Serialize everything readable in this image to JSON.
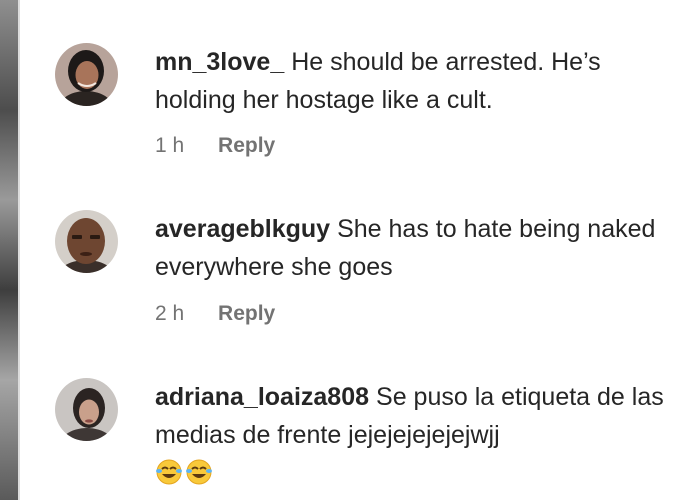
{
  "comments": [
    {
      "username": "mn_3love_",
      "text": "He should be arrested. He’s holding her hostage like a cult.",
      "time": "1 h",
      "reply_label": "Reply"
    },
    {
      "username": "averageblkguy",
      "text": "She has to hate being naked everywhere she goes",
      "time": "2 h",
      "reply_label": "Reply"
    },
    {
      "username": "adriana_loaiza808",
      "text": "Se puso la etiqueta de las medias de frente jejejejejejejwjj",
      "emoji": "😂😂"
    }
  ],
  "colors": {
    "text": "#262626",
    "meta": "#737373",
    "background": "#ffffff"
  },
  "icons": [
    "avatar-photo",
    "face-with-tears-of-joy-emoji"
  ]
}
